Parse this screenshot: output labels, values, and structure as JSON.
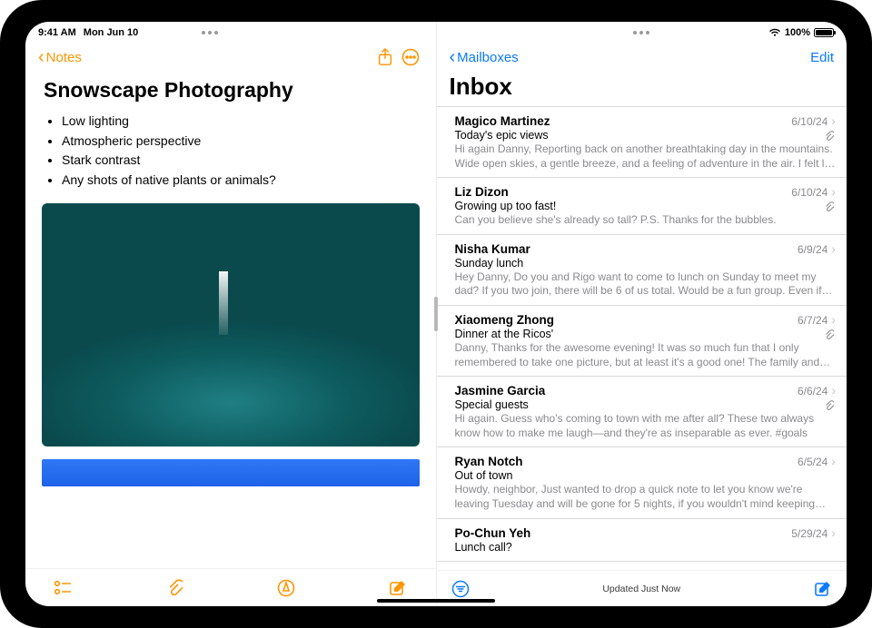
{
  "status": {
    "time": "9:41 AM",
    "date": "Mon Jun 10",
    "battery_pct": "100%"
  },
  "notes": {
    "back_label": "Notes",
    "title": "Snowscape Photography",
    "bullets": [
      "Low lighting",
      "Atmospheric perspective",
      "Stark contrast",
      "Any shots of native plants or animals?"
    ]
  },
  "mail": {
    "back_label": "Mailboxes",
    "edit_label": "Edit",
    "title": "Inbox",
    "updated_label": "Updated Just Now",
    "messages": [
      {
        "sender": "Magico Martinez",
        "date": "6/10/24",
        "subject": "Today's epic views",
        "preview": "Hi again Danny, Reporting back on another breathtaking day in the mountains. Wide open skies, a gentle breeze, and a feeling of adventure in the air. I felt l…",
        "attachment": true
      },
      {
        "sender": "Liz Dizon",
        "date": "6/10/24",
        "subject": "Growing up too fast!",
        "preview": "Can you believe she's already so tall? P.S. Thanks for the bubbles.",
        "attachment": true
      },
      {
        "sender": "Nisha Kumar",
        "date": "6/9/24",
        "subject": "Sunday lunch",
        "preview": "Hey Danny, Do you and Rigo want to come to lunch on Sunday to meet my dad? If you two join, there will be 6 of us total. Would be a fun group. Even if…",
        "attachment": false
      },
      {
        "sender": "Xiaomeng Zhong",
        "date": "6/7/24",
        "subject": "Dinner at the Ricos'",
        "preview": "Danny, Thanks for the awesome evening! It was so much fun that I only remembered to take one picture, but at least it's a good one! The family and…",
        "attachment": true
      },
      {
        "sender": "Jasmine Garcia",
        "date": "6/6/24",
        "subject": "Special guests",
        "preview": "Hi again. Guess who's coming to town with me after all? These two always know how to make me laugh—and they're as inseparable as ever. #goals",
        "attachment": true
      },
      {
        "sender": "Ryan Notch",
        "date": "6/5/24",
        "subject": "Out of town",
        "preview": "Howdy, neighbor, Just wanted to drop a quick note to let you know we're leaving Tuesday and will be gone for 5 nights, if you wouldn't mind keeping…",
        "attachment": false
      },
      {
        "sender": "Po-Chun Yeh",
        "date": "5/29/24",
        "subject": "Lunch call?",
        "preview": "",
        "attachment": false
      }
    ]
  }
}
